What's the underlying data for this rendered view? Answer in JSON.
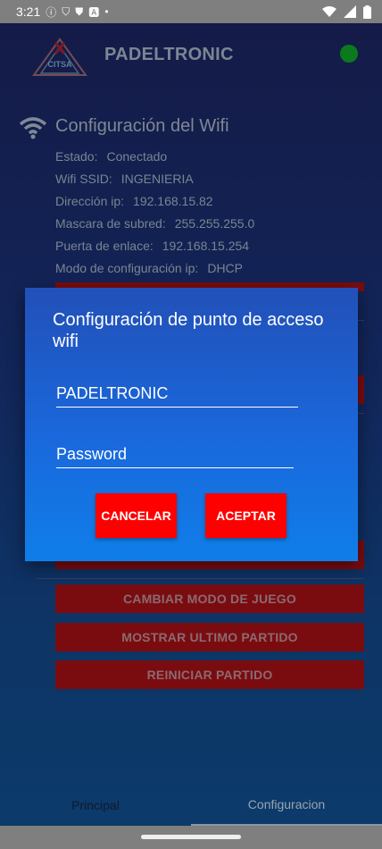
{
  "status_bar": {
    "time": "3:21",
    "icons": [
      "info-icon",
      "shield-icon",
      "shield-filled-icon",
      "a-box-icon",
      "dot-icon"
    ],
    "right_icons": [
      "wifi-icon",
      "cellular-signal-icon",
      "battery-icon"
    ]
  },
  "header": {
    "logo_text": "CITSA",
    "title": "PADELTRONIC",
    "connection_color": "#0a7a1c"
  },
  "wifi": {
    "title": "Configuración del Wifi",
    "rows": [
      {
        "label": "Estado:",
        "value": "Conectado"
      },
      {
        "label": "Wifi SSID:",
        "value": "INGENIERIA"
      },
      {
        "label": "Dirección ip:",
        "value": "192.168.15.82"
      },
      {
        "label": "Mascara de subred:",
        "value": "255.255.255.0"
      },
      {
        "label": "Puerta de enlace:",
        "value": "192.168.15.254"
      },
      {
        "label": "Modo de configuración ip:",
        "value": "DHCP"
      }
    ]
  },
  "actions": {
    "change_mode": "CAMBIAR MODO DE JUEGO",
    "show_last": "MOSTRAR ULTIMO PARTIDO",
    "restart": "REINICIAR PARTIDO"
  },
  "dialog": {
    "title": "Configuración de punto de acceso wifi",
    "ssid_value": "PADELTRONIC",
    "password_placeholder": "Password",
    "cancel_label": "CANCELAR",
    "accept_label": "ACEPTAR",
    "button_color": "#ff0000"
  },
  "nav": {
    "principal": "Principal",
    "config": "Configuracion",
    "active": "Configuracion"
  }
}
